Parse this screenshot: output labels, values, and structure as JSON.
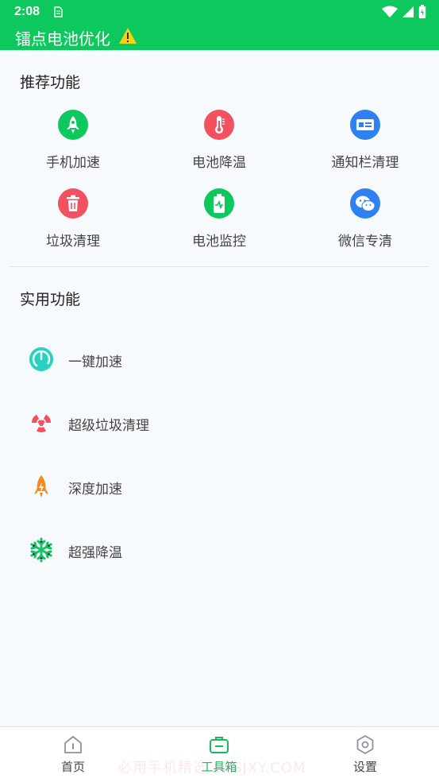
{
  "colors": {
    "brand": "#0dc85c",
    "accent_green": "#18b860",
    "red": "#f25260",
    "blue": "#2f80f0",
    "teal": "#24d3c0",
    "orange": "#f5891f"
  },
  "status_bar": {
    "time": "2:08"
  },
  "app": {
    "title": "镭点电池优化"
  },
  "recommended": {
    "title": "推荐功能",
    "items": [
      {
        "label": "手机加速",
        "icon": "rocket-icon"
      },
      {
        "label": "电池降温",
        "icon": "thermometer-icon"
      },
      {
        "label": "通知栏清理",
        "icon": "notification-card-icon"
      },
      {
        "label": "垃圾清理",
        "icon": "trash-icon"
      },
      {
        "label": "电池监控",
        "icon": "battery-monitor-icon"
      },
      {
        "label": "微信专清",
        "icon": "wechat-icon"
      }
    ]
  },
  "utilities": {
    "title": "实用功能",
    "items": [
      {
        "label": "一键加速",
        "icon": "speedometer-icon"
      },
      {
        "label": "超级垃圾清理",
        "icon": "radiation-icon"
      },
      {
        "label": "深度加速",
        "icon": "flame-rocket-icon"
      },
      {
        "label": "超强降温",
        "icon": "snowflake-icon"
      }
    ]
  },
  "bottom_nav": {
    "items": [
      {
        "label": "首页",
        "icon": "home-icon",
        "active": false
      },
      {
        "label": "工具箱",
        "icon": "toolbox-icon",
        "active": true
      },
      {
        "label": "设置",
        "icon": "settings-icon",
        "active": false
      }
    ]
  },
  "watermark": "必用手机精选 BYSJXY.COM"
}
